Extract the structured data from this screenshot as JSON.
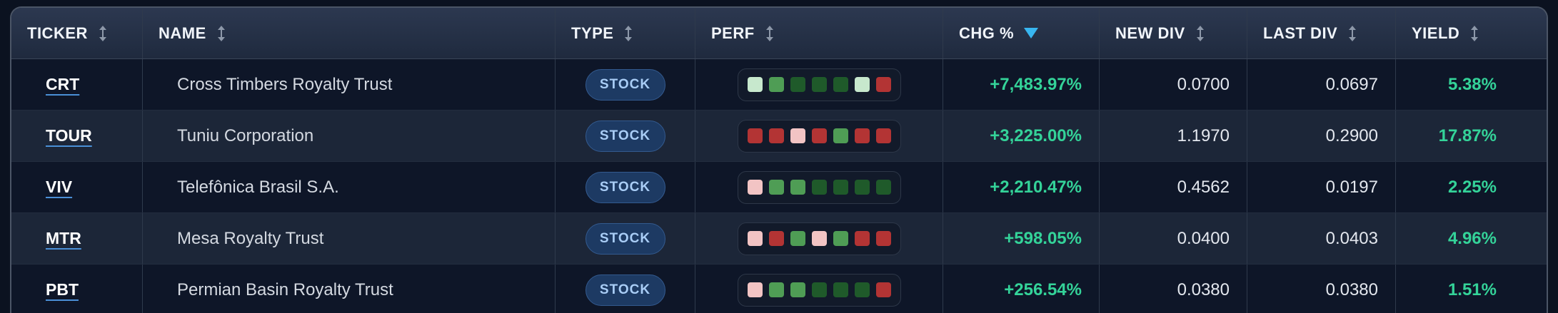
{
  "columns": {
    "ticker": "TICKER",
    "name": "NAME",
    "type": "TYPE",
    "perf": "PERF",
    "chg": "CHG %",
    "new_div": "NEW DIV",
    "last_div": "LAST DIV",
    "yield": "YIELD"
  },
  "sort": {
    "column": "chg",
    "direction": "descending",
    "indicator_color": "#38b6f0"
  },
  "perf_colors": {
    "light_green": "#c7e8cd",
    "green": "#4f9d55",
    "dark_green": "#1f5a2a",
    "light_red": "#f2c4c4",
    "red": "#b33434"
  },
  "rows": [
    {
      "ticker": "CRT",
      "name": "Cross Timbers Royalty Trust",
      "type": "STOCK",
      "perf": [
        "light_green",
        "green",
        "dark_green",
        "dark_green",
        "dark_green",
        "light_green",
        "red"
      ],
      "chg": "+7,483.97%",
      "new_div": "0.0700",
      "last_div": "0.0697",
      "yield": "5.38%"
    },
    {
      "ticker": "TOUR",
      "name": "Tuniu Corporation",
      "type": "STOCK",
      "perf": [
        "red",
        "red",
        "light_red",
        "red",
        "green",
        "red",
        "red"
      ],
      "chg": "+3,225.00%",
      "new_div": "1.1970",
      "last_div": "0.2900",
      "yield": "17.87%"
    },
    {
      "ticker": "VIV",
      "name": "Telefônica Brasil S.A.",
      "type": "STOCK",
      "perf": [
        "light_red",
        "green",
        "green",
        "dark_green",
        "dark_green",
        "dark_green",
        "dark_green"
      ],
      "chg": "+2,210.47%",
      "new_div": "0.4562",
      "last_div": "0.0197",
      "yield": "2.25%"
    },
    {
      "ticker": "MTR",
      "name": "Mesa Royalty Trust",
      "type": "STOCK",
      "perf": [
        "light_red",
        "red",
        "green",
        "light_red",
        "green",
        "red",
        "red"
      ],
      "chg": "+598.05%",
      "new_div": "0.0400",
      "last_div": "0.0403",
      "yield": "4.96%"
    },
    {
      "ticker": "PBT",
      "name": "Permian Basin Royalty Trust",
      "type": "STOCK",
      "perf": [
        "light_red",
        "green",
        "green",
        "dark_green",
        "dark_green",
        "dark_green",
        "red"
      ],
      "chg": "+256.54%",
      "new_div": "0.0380",
      "last_div": "0.0380",
      "yield": "1.51%"
    }
  ]
}
